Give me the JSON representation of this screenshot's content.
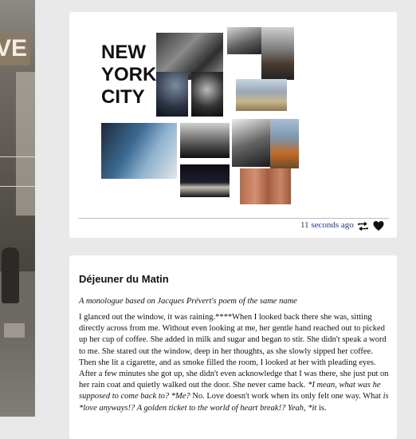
{
  "background": {
    "sign_fragment": "VE"
  },
  "post1": {
    "collage_heading_lines": [
      "NEW",
      "YORK",
      "CITY"
    ],
    "timestamp": "11 seconds ago",
    "icons": [
      "retweet-icon",
      "heart-icon"
    ]
  },
  "post2": {
    "title": "Déjeuner du Matin",
    "subtitle": "A monologue based on Jacques Prévert's poem of the same name",
    "body_plain": "I glanced out the window, it was raining.****When I looked back there she was, sitting directly across from me. Without even looking at me, her gentle hand reached out to picked up her cup of coffee. She added in milk and sugar and began to stir. She didn't speak a word to me. She stared out the window, deep in her thoughts, as she slowly sipped her coffee. Then she lit a cigarette, and as smoke filled the room, I looked at her with pleading eyes. After a few minutes she got up, she didn't even acknowledge that I was there, she just put on her rain coat and quietly walked out the door. She never came back. ",
    "body_italic_1": "*I mean, what was he supposed to come back to? *Me?",
    "body_plain_2": " No. Love doesn't work when its only felt one way. What ",
    "body_italic_2": "is *love anyways!? A golden ticket to the world of heart break!? Yeah, *it",
    "body_plain_3": " is."
  },
  "colors": {
    "link": "#2233aa",
    "card": "#ffffff",
    "page": "#e9e9e9"
  }
}
